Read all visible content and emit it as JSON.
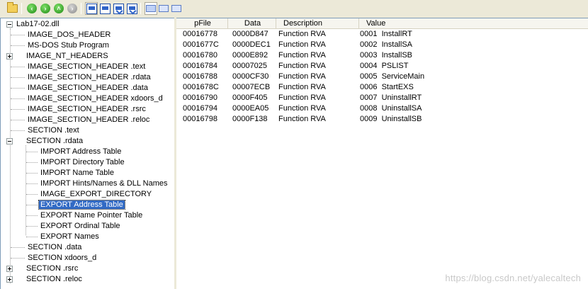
{
  "toolbar": {
    "buttons": [
      "open-folder-icon",
      "back-icon",
      "forward-icon",
      "up-icon",
      "go-icon",
      "data-view-icon",
      "text-view-icon",
      "pointer-view-icon",
      "address-view-icon",
      "view-mode-1-icon",
      "view-mode-2-icon",
      "view-mode-3-icon"
    ]
  },
  "tree": {
    "root": "Lab17-02.dll",
    "items": [
      "IMAGE_DOS_HEADER",
      "MS-DOS Stub Program",
      "IMAGE_NT_HEADERS",
      "IMAGE_SECTION_HEADER .text",
      "IMAGE_SECTION_HEADER .rdata",
      "IMAGE_SECTION_HEADER .data",
      "IMAGE_SECTION_HEADER xdoors_d",
      "IMAGE_SECTION_HEADER .rsrc",
      "IMAGE_SECTION_HEADER .reloc",
      "SECTION .text",
      "SECTION .rdata",
      "SECTION .data",
      "SECTION xdoors_d",
      "SECTION .rsrc",
      "SECTION .reloc"
    ],
    "rdata_children": [
      "IMPORT Address Table",
      "IMPORT Directory Table",
      "IMPORT Name Table",
      "IMPORT Hints/Names & DLL Names",
      "IMAGE_EXPORT_DIRECTORY",
      "EXPORT Address Table",
      "EXPORT Name Pointer Table",
      "EXPORT Ordinal Table",
      "EXPORT Names"
    ],
    "selected": "EXPORT Address Table"
  },
  "table": {
    "columns": [
      "pFile",
      "Data",
      "Description",
      "Value"
    ],
    "rows": [
      [
        "00016778",
        "0000D847",
        "Function RVA",
        "0001  InstallRT"
      ],
      [
        "0001677C",
        "0000DEC1",
        "Function RVA",
        "0002  InstallSA"
      ],
      [
        "00016780",
        "0000E892",
        "Function RVA",
        "0003  InstallSB"
      ],
      [
        "00016784",
        "00007025",
        "Function RVA",
        "0004  PSLIST"
      ],
      [
        "00016788",
        "0000CF30",
        "Function RVA",
        "0005  ServiceMain"
      ],
      [
        "0001678C",
        "00007ECB",
        "Function RVA",
        "0006  StartEXS"
      ],
      [
        "00016790",
        "0000F405",
        "Function RVA",
        "0007  UninstallRT"
      ],
      [
        "00016794",
        "0000EA05",
        "Function RVA",
        "0008  UninstallSA"
      ],
      [
        "00016798",
        "0000F138",
        "Function RVA",
        "0009  UninstallSB"
      ]
    ]
  },
  "watermark": "https://blog.csdn.net/yalecaltech",
  "colors": {
    "selection": "#316ac5",
    "window_bg": "#ece9d8"
  }
}
